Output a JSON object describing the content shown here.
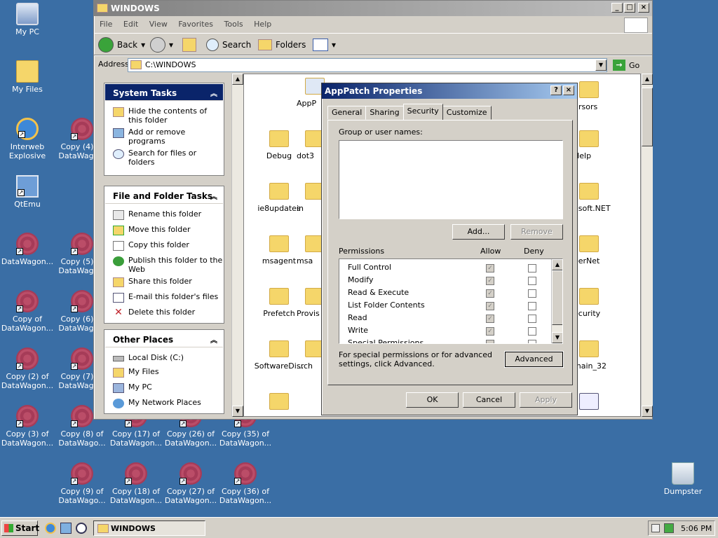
{
  "desktop": {
    "my_pc": "My PC",
    "my_files": "My Files",
    "internet": "Interweb Explosive",
    "qtemu": "QtEmu",
    "dw1": "DataWagon...",
    "cpy4": "Copy (4) of DataWago...",
    "cpy5": "Copy (5) of DataWago...",
    "cpyof": "Copy of DataWagon...",
    "cpy6": "Copy (6) of DataWago...",
    "cpy2": "Copy (2) of DataWagon...",
    "cpy7": "Copy (7) of DataWago...",
    "cpy3": "Copy (3) of DataWagon...",
    "cpy8": "Copy (8) of DataWago...",
    "cpy17": "Copy (17) of DataWagon...",
    "cpy26": "Copy (26) of DataWagon...",
    "cpy35": "Copy (35) of DataWagon...",
    "cpy9": "Copy (9) of DataWago...",
    "cpy18": "Copy (18) of DataWagon...",
    "cpy27": "Copy (27) of DataWagon...",
    "cpy36": "Copy (36) of DataWagon...",
    "dumpster": "Dumpster"
  },
  "explorer": {
    "title": "WINDOWS",
    "menu": [
      "File",
      "Edit",
      "View",
      "Favorites",
      "Tools",
      "Help"
    ],
    "toolbar": {
      "back": "Back",
      "search": "Search",
      "folders": "Folders"
    },
    "address_label": "Address",
    "address_value": "C:\\WINDOWS",
    "go": "Go",
    "system_tasks": {
      "title": "System Tasks",
      "items": [
        "Hide the contents of this folder",
        "Add or remove programs",
        "Search for files or folders"
      ]
    },
    "file_tasks": {
      "title": "File and Folder Tasks",
      "items": [
        "Rename this folder",
        "Move this folder",
        "Copy this folder",
        "Publish this folder to the Web",
        "Share this folder",
        "E-mail this folder's files",
        "Delete this folder"
      ]
    },
    "other_places": {
      "title": "Other Places",
      "items": [
        "Local Disk (C:)",
        "My Files",
        "My PC",
        "My Network Places"
      ]
    },
    "folders": {
      "c1": [
        "",
        "Debug",
        "ie8updates",
        "msagent",
        "Prefetch",
        "SoftwareDi..."
      ],
      "c2": [
        "AppP",
        "dot3",
        "in",
        "msa",
        "Provis",
        "srch"
      ],
      "c5": [
        "ursors",
        "Help",
        "osoft.NET",
        "eerNet",
        "ecurity",
        "main_32"
      ]
    }
  },
  "dialog": {
    "title": "AppPatch Properties",
    "tabs": [
      "General",
      "Sharing",
      "Security",
      "Customize"
    ],
    "group_label": "Group or user names:",
    "add": "Add...",
    "remove": "Remove",
    "perm_label": "Permissions",
    "allow": "Allow",
    "deny": "Deny",
    "permissions": [
      {
        "name": "Full Control",
        "allow": true
      },
      {
        "name": "Modify",
        "allow": true
      },
      {
        "name": "Read & Execute",
        "allow": true
      },
      {
        "name": "List Folder Contents",
        "allow": true
      },
      {
        "name": "Read",
        "allow": true
      },
      {
        "name": "Write",
        "allow": true
      },
      {
        "name": "Special Permissions",
        "allow": false
      }
    ],
    "special_text": "For special permissions or for advanced settings, click Advanced.",
    "advanced": "Advanced",
    "ok": "OK",
    "cancel": "Cancel",
    "apply": "Apply"
  },
  "taskbar": {
    "start": "Start",
    "task": "WINDOWS",
    "clock": "5:06 PM"
  },
  "colors": {
    "desktop": "#3a6ea5",
    "title_active": "#0a246a",
    "title_inactive": "#808080"
  }
}
